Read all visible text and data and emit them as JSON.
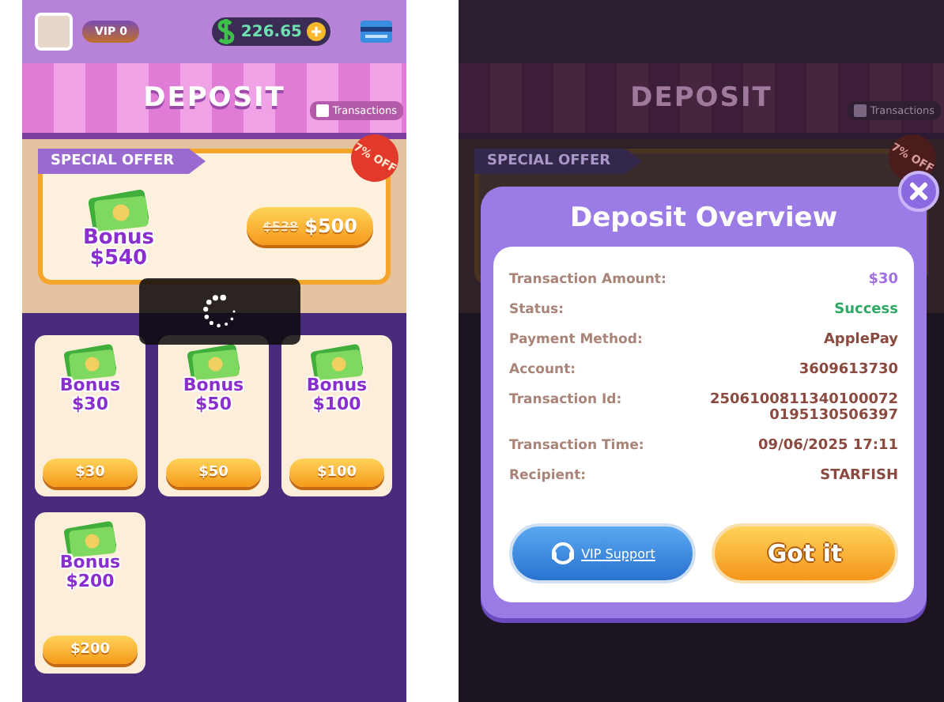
{
  "left_screen": {
    "top_bar": {
      "vip_level": "VIP 0",
      "balance": "226.65"
    },
    "header": {
      "title": "DEPOSIT",
      "transactions_link": "Transactions"
    },
    "special_offer": {
      "label": "SPECIAL OFFER",
      "discount_badge": "7% OFF",
      "bonus_word": "Bonus",
      "bonus_amount": "$540",
      "old_price": "$538",
      "price": "$500"
    },
    "packages": [
      {
        "bonus_word": "Bonus",
        "bonus_amount": "$30",
        "price": "$30"
      },
      {
        "bonus_word": "Bonus",
        "bonus_amount": "$50",
        "price": "$50"
      },
      {
        "bonus_word": "Bonus",
        "bonus_amount": "$100",
        "price": "$100"
      },
      {
        "bonus_word": "Bonus",
        "bonus_amount": "$200",
        "price": "$200"
      }
    ],
    "loading": true
  },
  "right_screen": {
    "background": {
      "title": "DEPOSIT",
      "transactions_link": "Transactions",
      "offer_label": "SPECIAL OFFER",
      "discount_badge": "7% OFF"
    },
    "dialog": {
      "title": "Deposit Overview",
      "rows": [
        {
          "label": "Transaction Amount:",
          "value": "$30",
          "kind": "amount"
        },
        {
          "label": "Status:",
          "value": "Success",
          "kind": "status"
        },
        {
          "label": "Payment Method:",
          "value": "ApplePay",
          "kind": "plain"
        },
        {
          "label": "Account:",
          "value": "3609613730",
          "kind": "plain"
        },
        {
          "label": "Transaction Id:",
          "value": "25061008113401000720195130506397",
          "kind": "plain"
        },
        {
          "label": "Transaction Time:",
          "value": "09/06/2025 17:11",
          "kind": "plain"
        },
        {
          "label": "Recipient:",
          "value": "STARFISH",
          "kind": "plain"
        }
      ],
      "support_button": "VIP Support",
      "confirm_button": "Got it"
    }
  }
}
